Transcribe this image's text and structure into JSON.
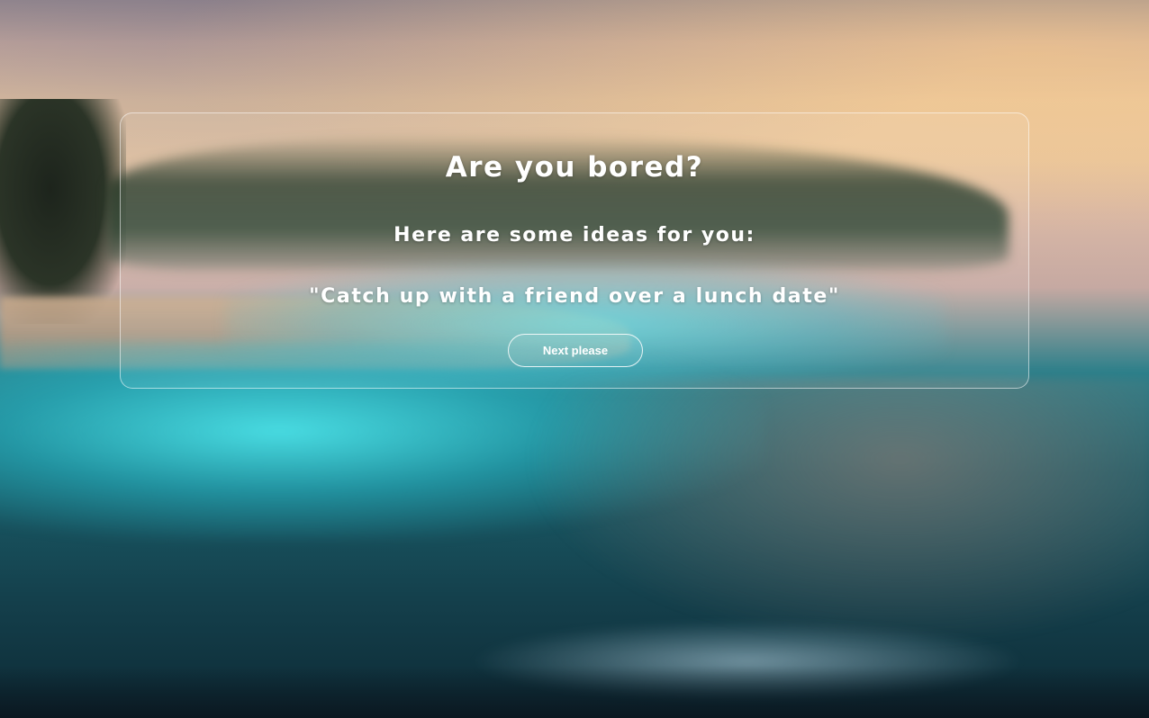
{
  "card": {
    "title": "Are you bored?",
    "subtitle": "Here are some ideas for you:",
    "idea": "\"Catch up with a friend over a lunch date\"",
    "next_button_label": "Next please"
  },
  "colors": {
    "text": "#ffffff",
    "card_border": "rgba(255,255,255,0.55)",
    "glow_accent": "#50f0f5"
  },
  "background": {
    "description_icon": "beach-sunset-background"
  }
}
